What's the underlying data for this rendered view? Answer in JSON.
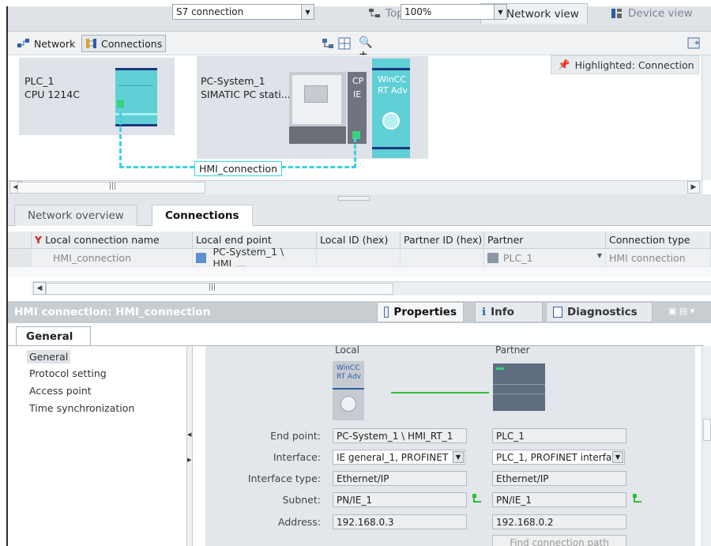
{
  "view_tabs": {
    "topology": "Topology view",
    "network": "Network view",
    "device": "Device view"
  },
  "toolbar": {
    "network_label": "Network",
    "connections_label": "Connections",
    "connection_type_value": "S7 connection",
    "zoom_value": "100%"
  },
  "canvas": {
    "highlighted_label": "Highlighted: Connection",
    "plc": {
      "name": "PLC_1",
      "type": "CPU 1214C"
    },
    "pc": {
      "name": "PC-System_1",
      "type": "SIMATIC PC stati...",
      "cp_label": "CP",
      "ie_label": "IE",
      "wincc_line1": "WinCC",
      "wincc_line2": "RT Adv"
    },
    "connection_label": "HMI_connection",
    "hscroll_glyph": "|||"
  },
  "overview_tabs": {
    "network_overview": "Network overview",
    "connections": "Connections"
  },
  "connections_table": {
    "columns": [
      "Local connection name",
      "Local end point",
      "Local ID (hex)",
      "Partner ID (hex)",
      "Partner",
      "Connection type"
    ],
    "rows": [
      {
        "name": "HMI_connection",
        "local_end_point": "PC-System_1 \\ HMI_...",
        "local_id": "",
        "partner_id": "",
        "partner": "PLC_1",
        "type": "HMI connection"
      }
    ],
    "hscroll_glyph": "|||"
  },
  "inspector": {
    "title": "HMI connection: HMI_connection",
    "tabs": {
      "properties": "Properties",
      "info": "Info",
      "diagnostics": "Diagnostics"
    },
    "general_tab": "General",
    "nav_items": [
      "General",
      "Protocol setting",
      "Access point",
      "Time synchronization"
    ],
    "local_header": "Local",
    "partner_header": "Partner",
    "local_device_line1": "WinCC",
    "local_device_line2": "RT Adv",
    "fields": {
      "end_point_label": "End point:",
      "interface_label": "Interface:",
      "interface_type_label": "Interface type:",
      "subnet_label": "Subnet:",
      "address_label": "Address:"
    },
    "local": {
      "end_point": "PC-System_1 \\ HMI_RT_1",
      "interface": "IE general_1, PROFINET",
      "interface_type": "Ethernet/IP",
      "subnet": "PN/IE_1",
      "address": "192.168.0.3"
    },
    "partner": {
      "end_point": "PLC_1",
      "interface": "PLC_1, PROFINET interfa",
      "interface_type": "Ethernet/IP",
      "subnet": "PN/IE_1",
      "address": "192.168.0.2"
    },
    "find_path_button": "Find connection path"
  },
  "colors": {
    "accent_cyan": "#3ad3e0",
    "teal_module": "#5fd0d6",
    "navy_bar": "#1d3680",
    "subnet_green": "#2fbf3a"
  }
}
